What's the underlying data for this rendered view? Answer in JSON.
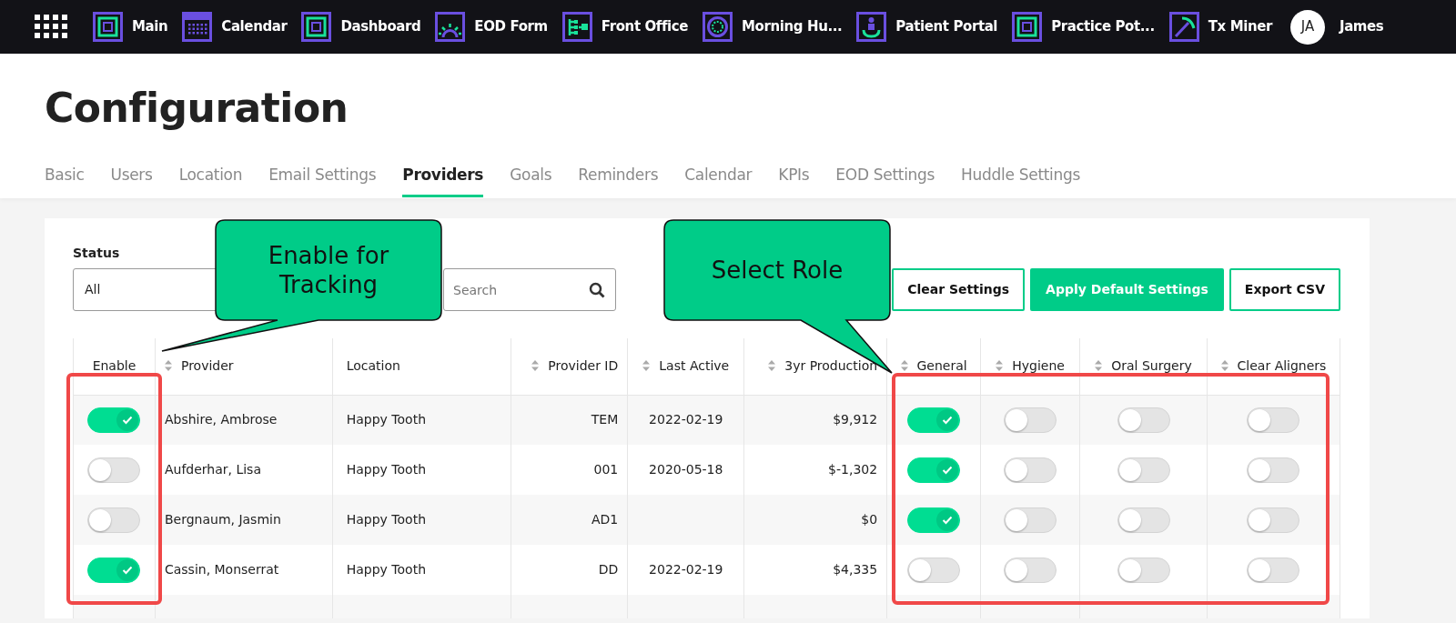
{
  "navbar": {
    "items": [
      {
        "label": "Main"
      },
      {
        "label": "Calendar"
      },
      {
        "label": "Dashboard"
      },
      {
        "label": "EOD Form"
      },
      {
        "label": "Front Office"
      },
      {
        "label": "Morning Hu..."
      },
      {
        "label": "Patient Portal"
      },
      {
        "label": "Practice Pot..."
      },
      {
        "label": "Tx Miner"
      }
    ],
    "user": {
      "initials": "JA",
      "name": "James"
    }
  },
  "page_title": "Configuration",
  "tabs": [
    {
      "label": "Basic",
      "selected": false
    },
    {
      "label": "Users",
      "selected": false
    },
    {
      "label": "Location",
      "selected": false
    },
    {
      "label": "Email Settings",
      "selected": false
    },
    {
      "label": "Providers",
      "selected": true
    },
    {
      "label": "Goals",
      "selected": false
    },
    {
      "label": "Reminders",
      "selected": false
    },
    {
      "label": "Calendar",
      "selected": false
    },
    {
      "label": "KPIs",
      "selected": false
    },
    {
      "label": "EOD Settings",
      "selected": false
    },
    {
      "label": "Huddle Settings",
      "selected": false
    }
  ],
  "filters": {
    "status_label": "Status",
    "status_value": "All",
    "search_placeholder": "Search"
  },
  "buttons": [
    {
      "label": "Clear Settings",
      "kind": "outline"
    },
    {
      "label": "Apply Default Settings",
      "kind": "primary"
    },
    {
      "label": "Export CSV",
      "kind": "outline"
    }
  ],
  "table": {
    "columns": [
      {
        "label": "Enable",
        "sortable": false
      },
      {
        "label": "Provider",
        "sortable": true
      },
      {
        "label": "Location",
        "sortable": false
      },
      {
        "label": "Provider ID",
        "sortable": true
      },
      {
        "label": "Last Active",
        "sortable": true
      },
      {
        "label": "3yr Production",
        "sortable": true
      },
      {
        "label": "General",
        "sortable": true
      },
      {
        "label": "Hygiene",
        "sortable": true
      },
      {
        "label": "Oral Surgery",
        "sortable": true
      },
      {
        "label": "Clear Aligners",
        "sortable": true
      }
    ],
    "rows": [
      {
        "enable": true,
        "provider": "Abshire, Ambrose",
        "location": "Happy Tooth",
        "provider_id": "TEM",
        "last_active": "2022-02-19",
        "production": "$9,912",
        "general": true,
        "hygiene": false,
        "oral_surgery": false,
        "clear_aligners": false
      },
      {
        "enable": false,
        "provider": "Aufderhar, Lisa",
        "location": "Happy Tooth",
        "provider_id": "001",
        "last_active": "2020-05-18",
        "production": "$-1,302",
        "general": true,
        "hygiene": false,
        "oral_surgery": false,
        "clear_aligners": false
      },
      {
        "enable": false,
        "provider": "Bergnaum, Jasmin",
        "location": "Happy Tooth",
        "provider_id": "AD1",
        "production": "$0",
        "general": true,
        "hygiene": false,
        "oral_surgery": false,
        "clear_aligners": false
      },
      {
        "enable": true,
        "provider": "Cassin, Monserrat",
        "location": "Happy Tooth",
        "provider_id": "DD",
        "last_active": "2022-02-19",
        "production": "$4,335",
        "general": false,
        "hygiene": false,
        "oral_surgery": false,
        "clear_aligners": false
      }
    ]
  },
  "annotations": [
    {
      "text": "Enable for Tracking"
    },
    {
      "text": "Select Role"
    }
  ]
}
